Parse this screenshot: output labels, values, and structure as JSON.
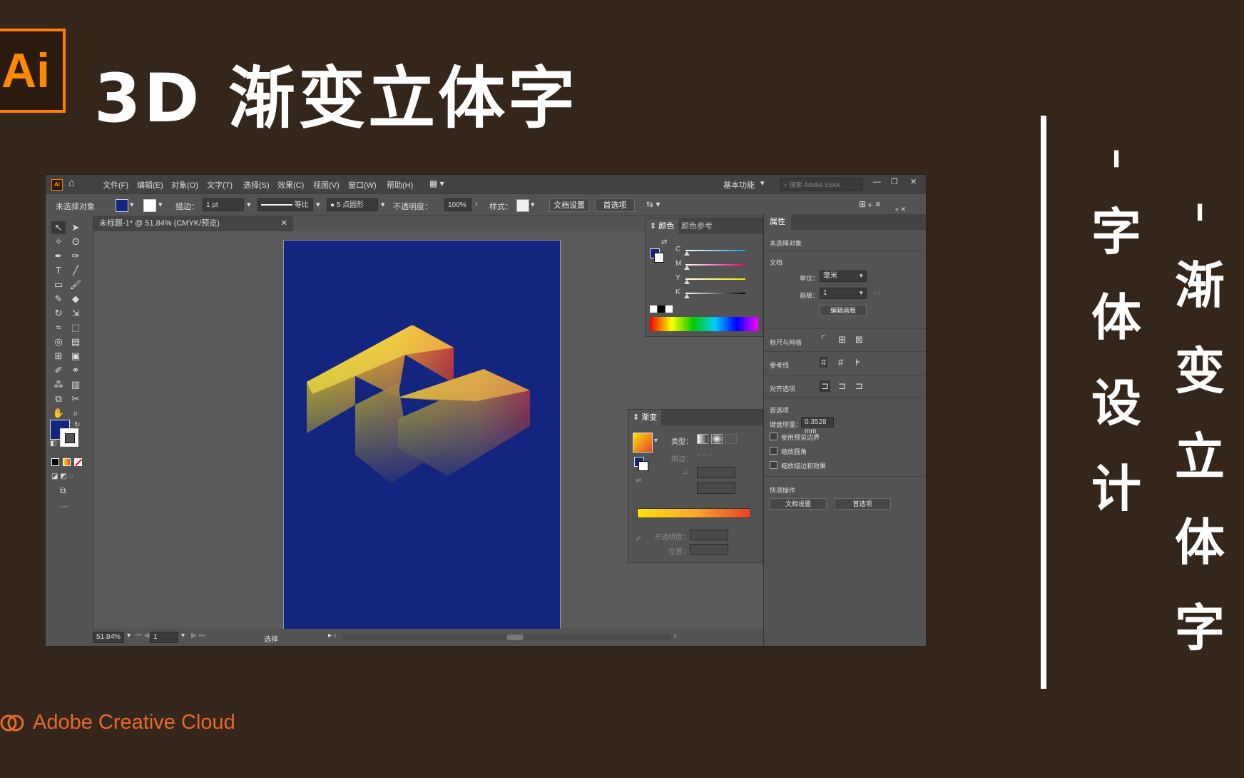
{
  "banner": {
    "logo_text": "Ai",
    "title": "3D 渐变立体字",
    "vertical_col1": [
      "字",
      "体",
      "设",
      "计"
    ],
    "vertical_col2": [
      "渐",
      "变",
      "立",
      "体",
      "字"
    ],
    "brand": "Adobe Creative Cloud",
    "colors": {
      "background": "#35261c",
      "logo_accent": "#ff7c00",
      "brand_text": "#e76a2a"
    }
  },
  "app": {
    "menu": [
      "文件(F)",
      "编辑(E)",
      "对象(O)",
      "文字(T)",
      "选择(S)",
      "效果(C)",
      "视图(V)",
      "窗口(W)",
      "帮助(H)"
    ],
    "workspace": "基本功能",
    "search_placeholder": "搜索 Adobe Stock",
    "control": {
      "no_selection": "未选择对象",
      "stroke_label": "描边：",
      "stroke_value": "1 pt",
      "profile_label": "等比",
      "brush_label": "5 点圆形",
      "opacity_label": "不透明度：",
      "opacity_value": "100%",
      "style_label": "样式：",
      "doc_setup": "文档设置",
      "preferences": "首选项"
    },
    "doc_tab": "未标题-1* @ 51.84% (CMYK/预览)",
    "status": {
      "zoom": "51.84%",
      "artboard": "1",
      "tool": "选择"
    },
    "color_panel": {
      "tabs": [
        "颜色",
        "颜色参考"
      ],
      "channels": [
        "C",
        "M",
        "Y",
        "K"
      ],
      "fill_color": "#13257f"
    },
    "gradient_panel": {
      "title": "渐变",
      "type_label": "类型：",
      "stroke_label": "描边：",
      "opacity_label": "不透明度：",
      "location_label": "位置：",
      "gradient_start": "#fbe20b",
      "gradient_end": "#e8432a"
    },
    "properties": {
      "tab": "属性",
      "no_selection": "未选择对象",
      "document": "文档",
      "units_label": "单位：",
      "units_value": "毫米",
      "artboard_label": "画板：",
      "artboard_value": "1",
      "edit_artboards": "编辑画板",
      "rulers_grid": "标尺与网格",
      "guides": "参考线",
      "snap_options": "对齐选项",
      "preferences_section": "首选项",
      "keyboard_increment_label": "键盘增量：",
      "keyboard_increment_value": "0.3528 mm",
      "checkboxes": [
        "使用预览边界",
        "缩放圆角",
        "缩放描边和效果"
      ],
      "quick_actions": "快速操作",
      "doc_setup_btn": "文档设置",
      "prefs_btn": "首选项"
    }
  }
}
